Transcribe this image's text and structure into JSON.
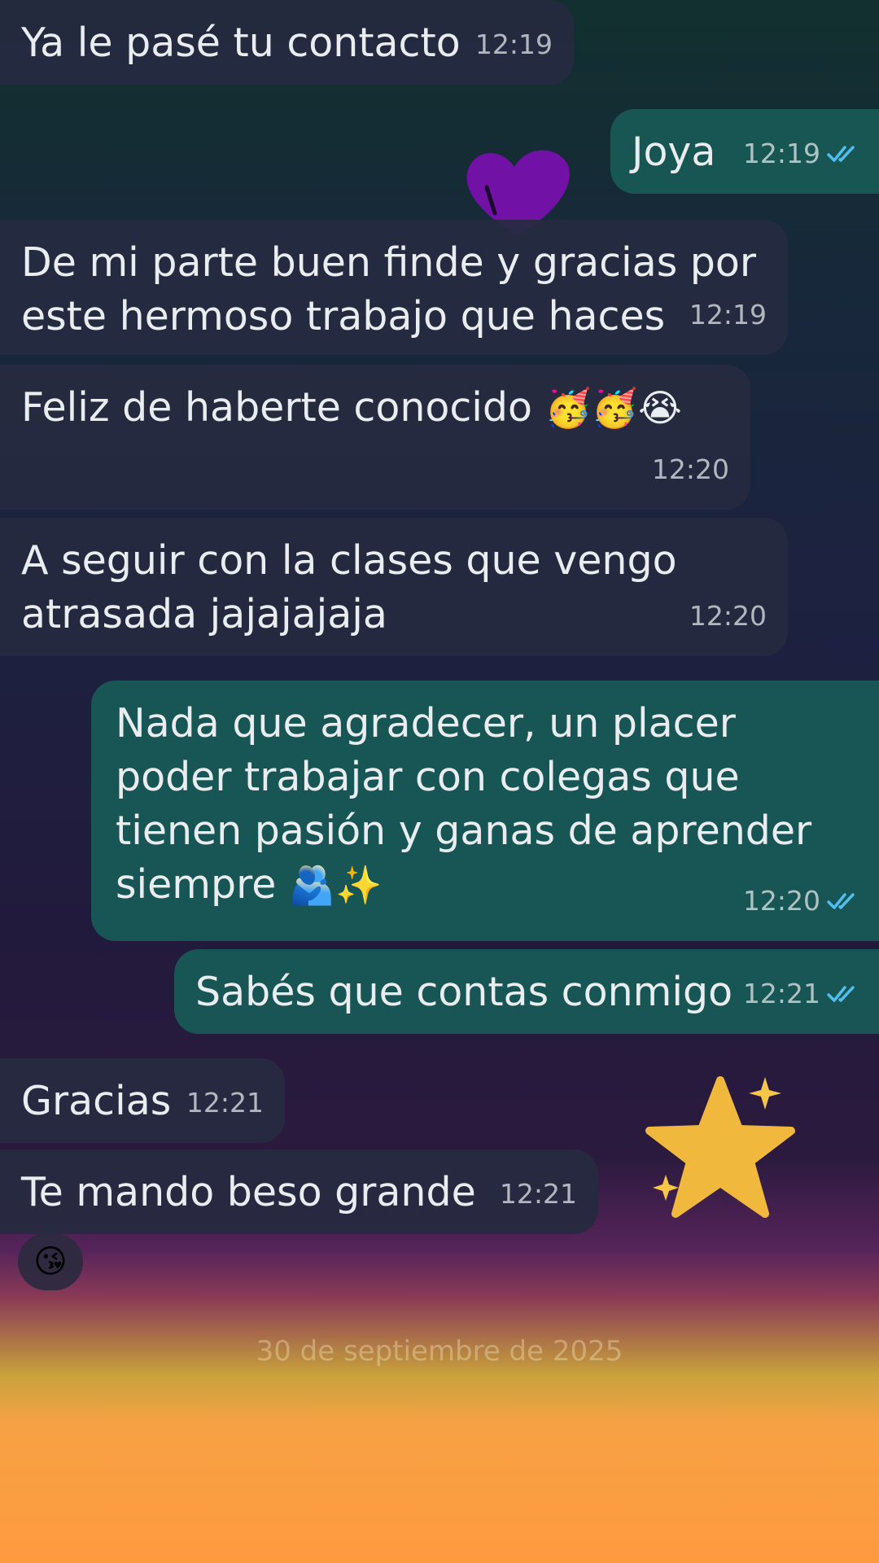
{
  "messages": [
    {
      "dir": "in",
      "text": "Ya le pasé tu contacto",
      "time": "12:19"
    },
    {
      "dir": "out",
      "text": "Joya",
      "time": "12:19"
    },
    {
      "dir": "in",
      "text": "De mi parte buen finde y gracias por este hermoso trabajo que haces",
      "time": "12:19"
    },
    {
      "dir": "in",
      "text": "Feliz de haberte conocido",
      "emoji": "🥳🥳😭",
      "time": "12:20"
    },
    {
      "dir": "in",
      "text": "A seguir con la clases que vengo atrasada jajajajaja",
      "time": "12:20"
    },
    {
      "dir": "out",
      "text": "Nada que agradecer, un placer poder trabajar con colegas que tienen pasión y ganas de aprender siempre",
      "emoji": "🫂✨",
      "time": "12:20"
    },
    {
      "dir": "out",
      "text": "Sabés que contas conmigo",
      "time": "12:21"
    },
    {
      "dir": "in",
      "text": "Gracias",
      "time": "12:21"
    },
    {
      "dir": "in",
      "text": "Te mando beso grande",
      "time": "12:21"
    }
  ],
  "reaction": {
    "emoji": "😘"
  },
  "date_divider": "30 de septiembre de 2025",
  "colors": {
    "incoming_bubble": "#262a40",
    "outgoing_bubble": "#185856",
    "read_ticks": "#53bdeb",
    "heart_sticker": "#7b0fb0",
    "star_sticker": "#f0b93e",
    "bottom_gradient": "#ff9a3f"
  },
  "icons": {
    "read": "double-check-icon",
    "heart": "heart-sticker",
    "star": "star-sticker"
  }
}
